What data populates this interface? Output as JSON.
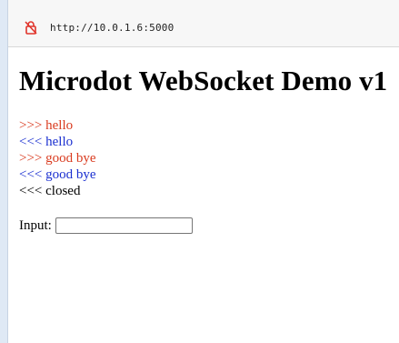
{
  "browser": {
    "url": "http://10.0.1.6:5000",
    "lock_icon": "insecure-lock-icon",
    "lock_color": "#e0342b"
  },
  "page": {
    "title": "Microdot WebSocket Demo v1",
    "log": [
      {
        "prefix": ">>>",
        "text": "hello",
        "type": "sent"
      },
      {
        "prefix": "<<<",
        "text": "hello",
        "type": "recv"
      },
      {
        "prefix": ">>>",
        "text": "good bye",
        "type": "sent"
      },
      {
        "prefix": "<<<",
        "text": "good bye",
        "type": "recv"
      },
      {
        "prefix": "<<<",
        "text": "closed",
        "type": "plain"
      }
    ],
    "input_label": "Input:",
    "input_value": ""
  },
  "colors": {
    "sent": "#d93a1e",
    "recv": "#1a2fd0",
    "plain": "#000000"
  }
}
